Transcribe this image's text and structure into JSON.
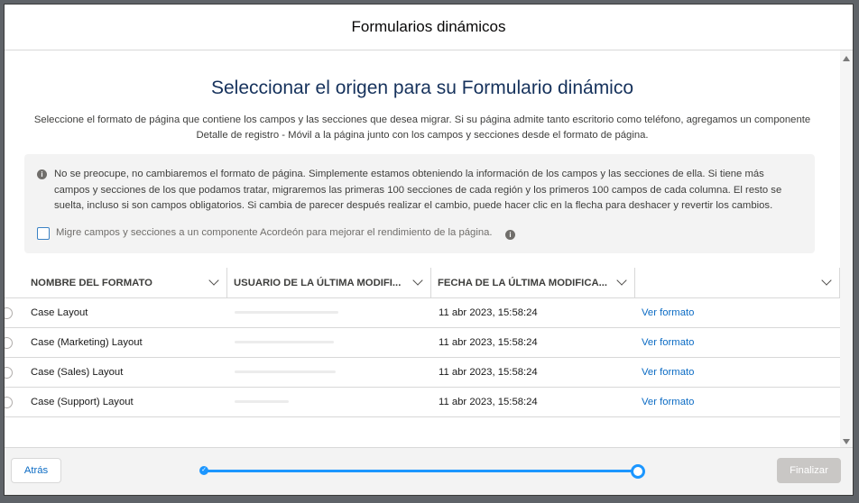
{
  "modal": {
    "title": "Formularios dinámicos"
  },
  "main": {
    "heading": "Seleccionar el origen para su Formulario dinámico",
    "description": "Seleccione el formato de página que contiene los campos y las secciones que desea migrar. Si su página admite tanto escritorio como teléfono, agregamos un componente Detalle de registro - Móvil a la página junto con los campos y secciones desde el formato de página."
  },
  "info": {
    "icon": "info-icon",
    "text": "No se preocupe, no cambiaremos el formato de página. Simplemente estamos obteniendo la información de los campos y las secciones de ella. Si tiene más campos y secciones de los que podamos tratar, migraremos las primeras 100 secciones de cada región y los primeros 100 campos de cada columna. El resto se suelta, incluso si son campos obligatorios. Si cambia de parecer después realizar el cambio, puede hacer clic en la flecha para deshacer y revertir los cambios.",
    "checkbox_label": "Migre campos y secciones a un componente Acordeón para mejorar el rendimiento de la página.",
    "checkbox_checked": false
  },
  "table": {
    "columns": [
      "NOMBRE DEL FORMATO",
      "USUARIO DE LA ÚLTIMA MODIFI...",
      "FECHA DE LA ÚLTIMA MODIFICA...",
      ""
    ],
    "rows": [
      {
        "name": "Case Layout",
        "date": "11 abr 2023, 15:58:24",
        "action": "Ver formato"
      },
      {
        "name": "Case (Marketing) Layout",
        "date": "11 abr 2023, 15:58:24",
        "action": "Ver formato"
      },
      {
        "name": "Case (Sales) Layout",
        "date": "11 abr 2023, 15:58:24",
        "action": "Ver formato"
      },
      {
        "name": "Case (Support) Layout",
        "date": "11 abr 2023, 15:58:24",
        "action": "Ver formato"
      }
    ]
  },
  "footer": {
    "back_label": "Atrás",
    "finish_label": "Finalizar",
    "progress": {
      "current_step": 2,
      "total_steps": 2
    }
  },
  "colors": {
    "accent": "#1b96ff",
    "link": "#0b6bc4",
    "heading": "#16325c"
  }
}
